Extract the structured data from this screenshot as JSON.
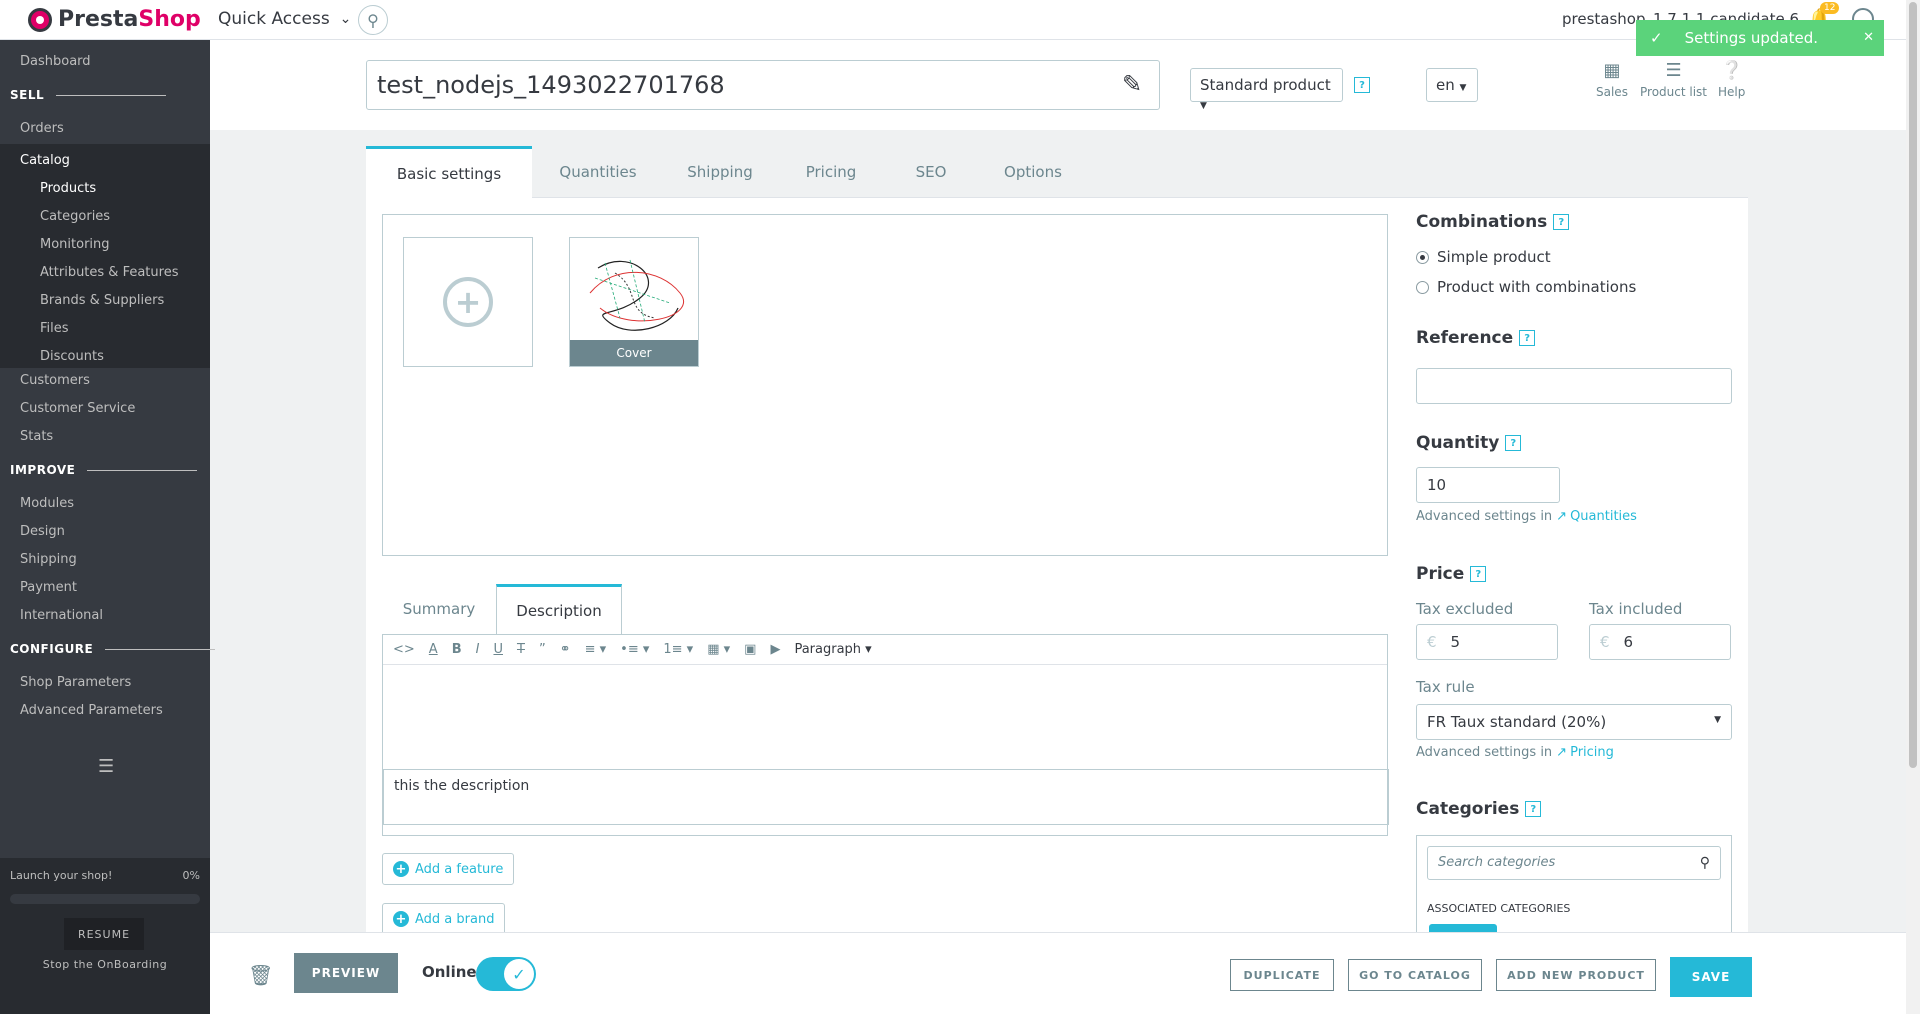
{
  "header": {
    "logo_text_a": "Presta",
    "logo_text_b": "Shop",
    "quick_access": "Quick Access",
    "shop_name": "prestashop_1.7.1.1 candidate 6",
    "notification_count": "12",
    "toast": "Settings updated."
  },
  "sidebar": {
    "dashboard": "Dashboard",
    "sell": "SELL",
    "orders": "Orders",
    "catalog": "Catalog",
    "catalog_items": [
      "Products",
      "Categories",
      "Monitoring",
      "Attributes & Features",
      "Brands & Suppliers",
      "Files",
      "Discounts"
    ],
    "customers": "Customers",
    "customer_service": "Customer Service",
    "stats": "Stats",
    "improve": "IMPROVE",
    "improve_items": [
      "Modules",
      "Design",
      "Shipping",
      "Payment",
      "International"
    ],
    "configure": "CONFIGURE",
    "configure_items": [
      "Shop Parameters",
      "Advanced Parameters"
    ],
    "launch": "Launch your shop!",
    "launch_pct": "0%",
    "launch_progress": 0,
    "resume": "RESUME",
    "stop_onboarding": "Stop the OnBoarding"
  },
  "product": {
    "name": "test_nodejs_1493022701768",
    "type": "Standard product",
    "lang": "en",
    "actions": [
      "Sales",
      "Product list",
      "Help"
    ]
  },
  "tabs": [
    "Basic settings",
    "Quantities",
    "Shipping",
    "Pricing",
    "SEO",
    "Options"
  ],
  "images": {
    "cover_label": "Cover"
  },
  "desc_tabs": [
    "Summary",
    "Description"
  ],
  "editor": {
    "paragraph": "Paragraph",
    "content": "this the description"
  },
  "add_feature": "Add a feature",
  "add_brand": "Add a brand",
  "right": {
    "combinations": "Combinations",
    "simple_product": "Simple product",
    "product_with_combinations": "Product with combinations",
    "reference": "Reference",
    "reference_value": "",
    "quantity": "Quantity",
    "quantity_value": "10",
    "advanced_settings_in": "Advanced settings in",
    "quantities_link": "Quantities",
    "price": "Price",
    "tax_excluded": "Tax excluded",
    "tax_included": "Tax included",
    "currency": "€",
    "price_excl": "5",
    "price_incl": "6",
    "tax_rule": "Tax rule",
    "tax_rule_value": "FR Taux standard (20%)",
    "pricing_link": "Pricing",
    "categories": "Categories",
    "search_categories": "Search categories",
    "associated_categories": "ASSOCIATED CATEGORIES"
  },
  "bottom": {
    "preview": "PREVIEW",
    "online": "Online",
    "duplicate": "DUPLICATE",
    "go_to_catalog": "GO TO CATALOG",
    "add_new_product": "ADD NEW PRODUCT",
    "save": "SAVE"
  }
}
